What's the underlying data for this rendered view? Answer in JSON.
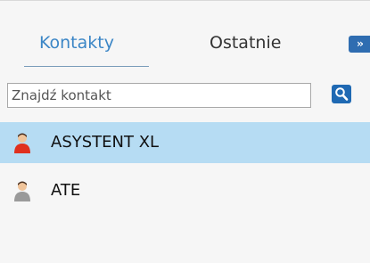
{
  "tabs": {
    "contacts_label": "Kontakty",
    "recent_label": "Ostatnie",
    "more_label": "»"
  },
  "search": {
    "placeholder": "Znajdź kontakt",
    "value": ""
  },
  "contacts": [
    {
      "name": "ASYSTENT XL",
      "selected": true,
      "status_color": "#e0301e",
      "icon": "user-red-icon"
    },
    {
      "name": "ATE",
      "selected": false,
      "status_color": "#9a9a9a",
      "icon": "user-gray-icon"
    }
  ],
  "colors": {
    "accent": "#3b86c6",
    "selection": "#b6dcf3",
    "button": "#1f69b3"
  }
}
